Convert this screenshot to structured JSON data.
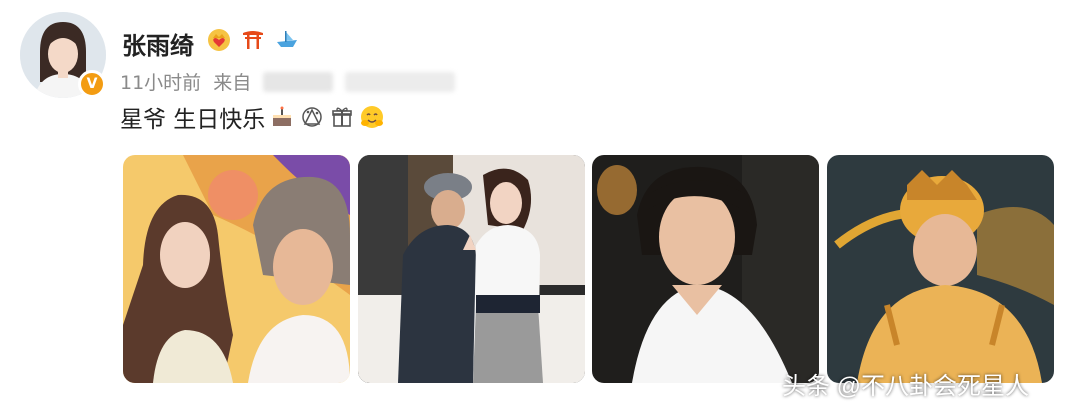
{
  "user": {
    "name": "张雨绮",
    "time": "11小时前",
    "source_prefix": "来自",
    "verified_icon": "v-badge-icon",
    "badge_icons": [
      "crown-heart-icon",
      "torii-icon",
      "boat-icon"
    ]
  },
  "post": {
    "text": "星爷 生日快乐",
    "emojis": [
      "cake-icon",
      "party-icon",
      "gift-icon",
      "hug-icon"
    ]
  },
  "photos": [
    {
      "name": "photo-1"
    },
    {
      "name": "photo-2"
    },
    {
      "name": "photo-3"
    },
    {
      "name": "photo-4"
    }
  ],
  "watermark": "头条 @不八卦会死星人",
  "colors": {
    "verified": "#f39c12",
    "text": "#222222",
    "meta": "#8a8a8a"
  }
}
